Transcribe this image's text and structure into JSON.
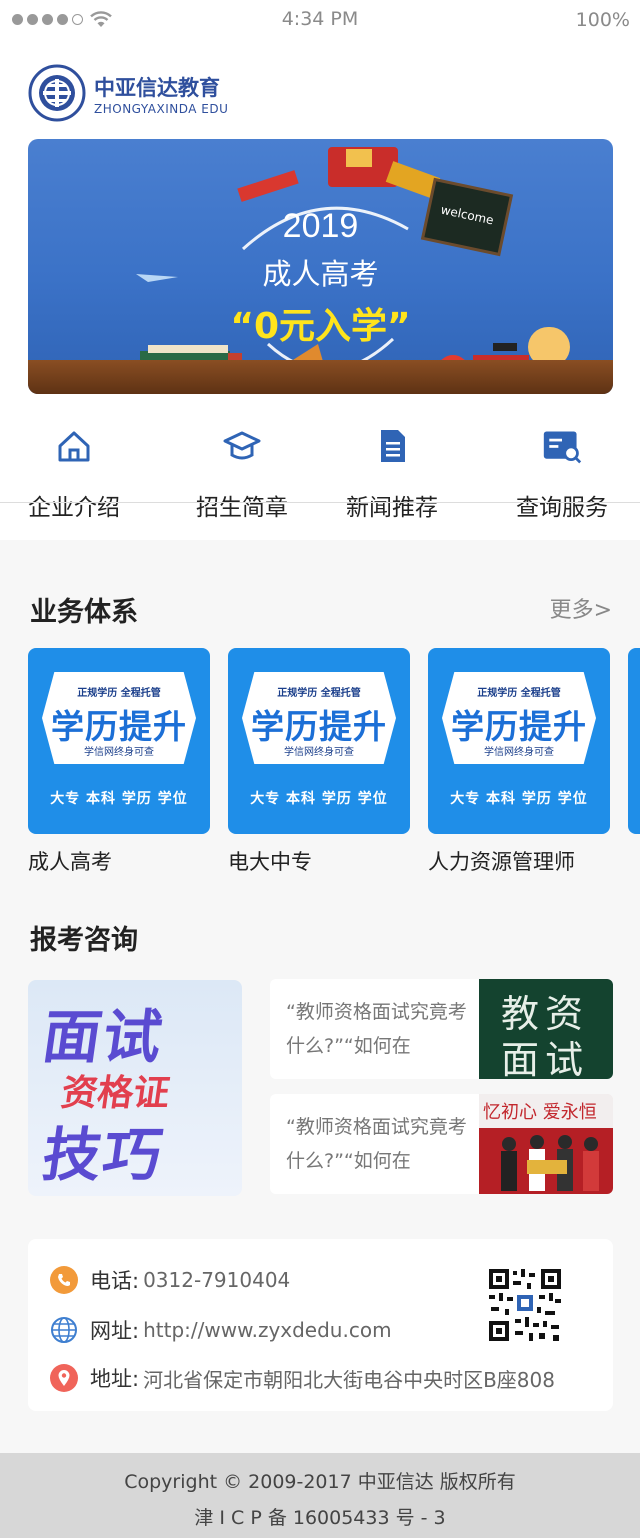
{
  "status_bar": {
    "time": "4:34 PM",
    "battery": "100%"
  },
  "brand": {
    "name_cn": "中亚信达教育",
    "name_en": "ZHONGYAXINDA EDU"
  },
  "banner": {
    "year": "2019",
    "title": "成人高考",
    "slogan": "“0元入学”",
    "welcome_sign": "welcome"
  },
  "quick_nav": [
    {
      "label": "企业介绍",
      "icon": "home-icon"
    },
    {
      "label": "招生简章",
      "icon": "graduation-cap-icon"
    },
    {
      "label": "新闻推荐",
      "icon": "document-icon"
    },
    {
      "label": "查询服务",
      "icon": "search-icon"
    }
  ],
  "business": {
    "title": "业务体系",
    "more": "更多>",
    "card_art": {
      "top_line": "正规学历 全程托管",
      "main": "学历提升",
      "sub": "学信网终身可查",
      "bottom": "大专 本科 学历 学位"
    },
    "cards": [
      {
        "label": "成人高考"
      },
      {
        "label": "电大中专"
      },
      {
        "label": "人力资源管理师"
      }
    ]
  },
  "consult": {
    "title": "报考咨询",
    "feature": {
      "line1": "面试",
      "line2": "资格证",
      "line3": "技巧"
    },
    "articles": [
      {
        "text": "“教师资格面试究竟考什么?”“如何在",
        "thumb_text": "教资面试"
      },
      {
        "text": "“教师资格面试究竟考什么?”“如何在",
        "thumb_text": "忆初心 爱永恒"
      }
    ]
  },
  "contact": {
    "phone_label": "电话:",
    "phone": "0312-7910404",
    "web_label": "网址:",
    "web": "http://www.zyxdedu.com",
    "address_label": "地址:",
    "address": "河北省保定市朝阳北大街电谷中央时区B座808"
  },
  "footer": {
    "copyright": "Copyright  © 2009-2017 中亚信达 版权所有",
    "icp": "津 I C P 备 16005433 号 - 3"
  },
  "colors": {
    "brand_blue": "#2f4f9d",
    "banner_blue": "#3b72c7",
    "card_blue": "#1f8ee8",
    "slogan_yellow": "#ffe41c",
    "phone_orange": "#f29a3a",
    "location_red": "#f0645a"
  }
}
